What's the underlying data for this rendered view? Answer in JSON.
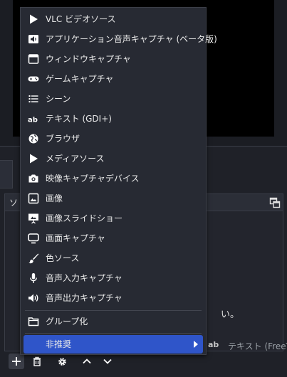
{
  "context_menu": {
    "items": [
      {
        "label": "VLC ビデオソース",
        "icon": "play-icon"
      },
      {
        "label": "アプリケーション音声キャプチャ (ベータ版)",
        "icon": "app-audio-icon"
      },
      {
        "label": "ウィンドウキャプチャ",
        "icon": "window-icon"
      },
      {
        "label": "ゲームキャプチャ",
        "icon": "gamepad-icon"
      },
      {
        "label": "シーン",
        "icon": "list-icon"
      },
      {
        "label": "テキスト (GDI+)",
        "icon": "text-ab-icon"
      },
      {
        "label": "ブラウザ",
        "icon": "globe-icon"
      },
      {
        "label": "メディアソース",
        "icon": "play-icon"
      },
      {
        "label": "映像キャプチャデバイス",
        "icon": "camera-icon"
      },
      {
        "label": "画像",
        "icon": "image-icon"
      },
      {
        "label": "画像スライドショー",
        "icon": "slideshow-icon"
      },
      {
        "label": "画面キャプチャ",
        "icon": "monitor-icon"
      },
      {
        "label": "色ソース",
        "icon": "brush-icon"
      },
      {
        "label": "音声入力キャプチャ",
        "icon": "microphone-icon"
      },
      {
        "label": "音声出力キャプチャ",
        "icon": "speaker-icon"
      },
      {
        "label": "グループ化",
        "icon": "folder-icon"
      },
      {
        "label": "非推奨",
        "icon": "",
        "submenu": true
      }
    ]
  },
  "sources_dock": {
    "title_partial": "ソ",
    "hint_partial": "い。",
    "list_item": {
      "icon": "ab",
      "label_partial": "テキスト (FreeTy"
    }
  },
  "colors": {
    "menu_background": "#272a33",
    "selected_highlight": "#2f55c9",
    "window_background": "#1f2128"
  }
}
